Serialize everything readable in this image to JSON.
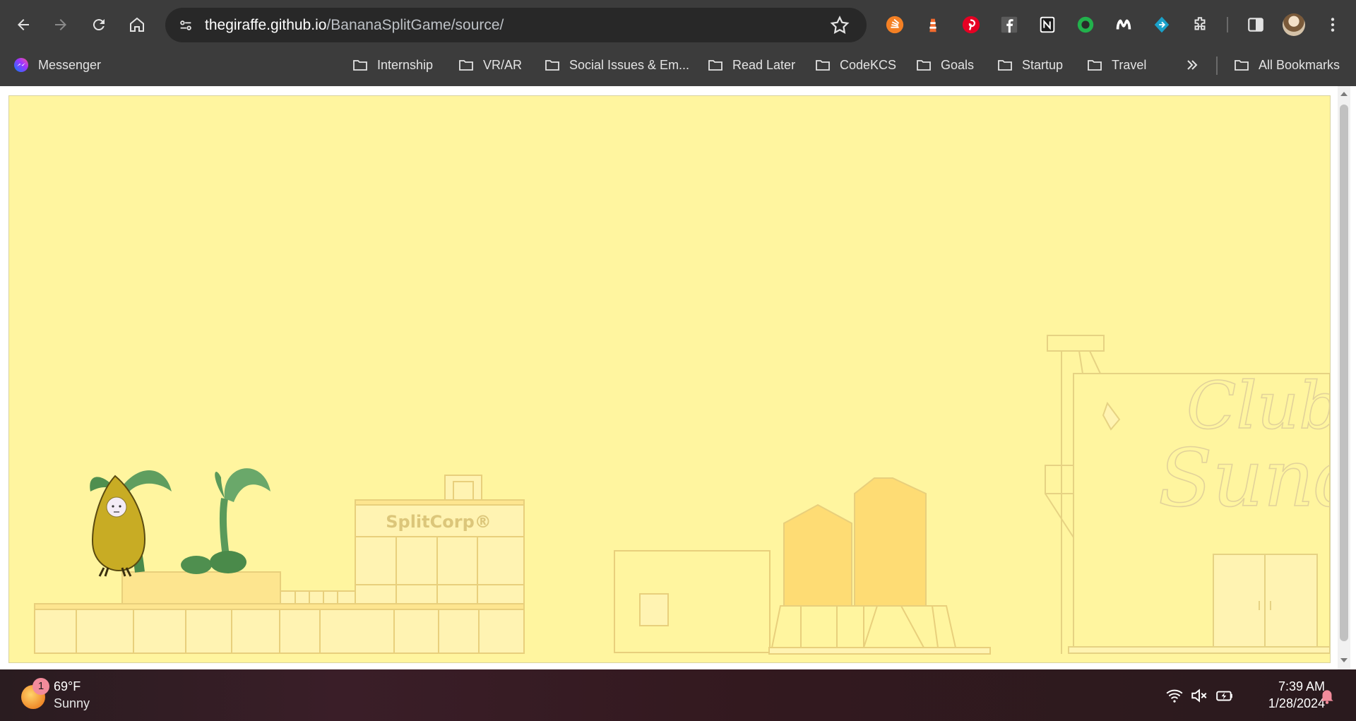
{
  "browser": {
    "url_host": "thegiraffe.github.io",
    "url_path": "/BananaSplitGame/source/",
    "bookmarks": [
      {
        "label": "Messenger",
        "icon": "messenger-icon"
      },
      {
        "label": "Internship",
        "icon": "folder-icon"
      },
      {
        "label": "VR/AR",
        "icon": "folder-icon"
      },
      {
        "label": "Social Issues & Em...",
        "icon": "folder-icon"
      },
      {
        "label": "Read Later",
        "icon": "folder-icon"
      },
      {
        "label": "CodeKCS",
        "icon": "folder-icon"
      },
      {
        "label": "Goals",
        "icon": "folder-icon"
      },
      {
        "label": "Startup",
        "icon": "folder-icon"
      },
      {
        "label": "Travel",
        "icon": "folder-icon"
      }
    ],
    "all_bookmarks": "All Bookmarks",
    "extensions": [
      "stackoverflow-icon",
      "lighthouse-icon",
      "pinterest-icon",
      "facebook-icon",
      "notion-icon",
      "circle-extension-icon",
      "malwarebytes-icon",
      "link-extension-icon",
      "puzzle-icon"
    ]
  },
  "game": {
    "background": "#fff59f",
    "building_sign": "SplitCorp®",
    "club_sign_line1": "Club",
    "club_sign_line2": "Sunda"
  },
  "taskbar": {
    "weather_badge": "1",
    "temperature": "69°F",
    "condition": "Sunny",
    "time": "7:39 AM",
    "date": "1/28/2024"
  }
}
